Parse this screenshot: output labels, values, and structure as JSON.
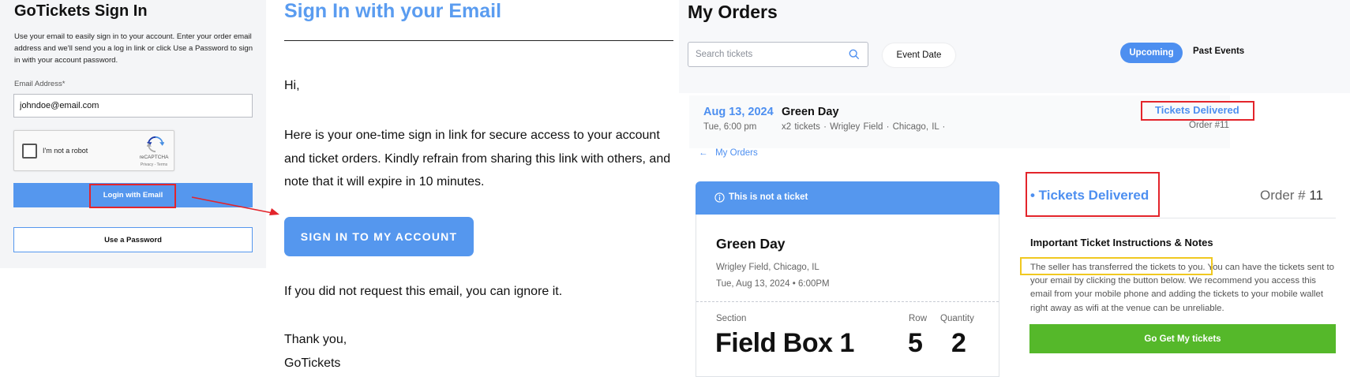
{
  "signin": {
    "title": "GoTickets Sign In",
    "intro": "Use your email to easily sign in to your account. Enter your order email address and we'll send you a log in link or click Use a Password to sign in with your account password.",
    "email_label": "Email Address*",
    "email_value": "johndoe@email.com",
    "captcha_text": "I'm not a robot",
    "captcha_brand": "reCAPTCHA",
    "captcha_terms": "Privacy - Terms",
    "login_button": "Login with Email",
    "password_button": "Use a Password"
  },
  "email": {
    "title": "Sign In with your Email",
    "greeting": "Hi,",
    "body": "Here is your one-time sign in link for secure access to your account and ticket orders. Kindly refrain from sharing this link with others, and note that it will expire in 10 minutes.",
    "button": "SIGN IN TO MY ACCOUNT",
    "ignore": "If you did not request this email, you can ignore it.",
    "thanks": "Thank you,",
    "signature": "GoTickets"
  },
  "orders": {
    "title": "My Orders",
    "search_placeholder": "Search tickets",
    "event_date_button": "Event Date",
    "tab_upcoming": "Upcoming",
    "tab_past": "Past Events",
    "order": {
      "date": "Aug 13, 2024",
      "event": "Green Day",
      "time": "Tue, 6:00 pm",
      "meta": "x2 tickets  ·  Wrigley Field  ·  Chicago, IL  ·",
      "status": "Tickets Delivered",
      "order_number": "Order #11"
    },
    "back_link": "My Orders"
  },
  "ticket": {
    "banner": "This is not a ticket",
    "event": "Green Day",
    "venue": "Wrigley Field, Chicago, IL",
    "datetime": "Tue, Aug 13, 2024 • 6:00PM",
    "section_label": "Section",
    "row_label": "Row",
    "quantity_label": "Quantity",
    "section_value": "Field Box 1",
    "row_value": "5",
    "quantity_value": "2"
  },
  "details": {
    "status": "• Tickets Delivered",
    "order_prefix": "Order # ",
    "order_number": "11",
    "instructions_title": "Important Ticket Instructions & Notes",
    "instructions": "The seller has transferred the tickets to you. You can have the tickets sent to your email by clicking the button below. We recommend you access this email from your mobile phone and adding the tickets to your mobile wallet right away as wifi at the venue can be unreliable.",
    "button": "Go Get My tickets"
  },
  "colors": {
    "accent": "#5597ee",
    "highlight_red": "#e3242b",
    "highlight_yellow": "#f0c820",
    "go_green": "#55b82a"
  }
}
